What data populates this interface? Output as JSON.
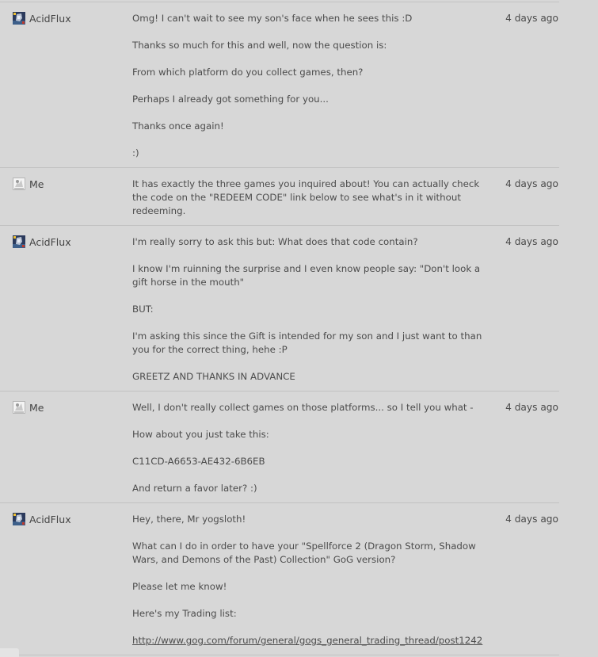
{
  "thread": {
    "messages": [
      {
        "sender": "AcidFlux",
        "avatar": "acidflux-avatar",
        "time": "4 days ago",
        "paragraphs": [
          "Omg! I can't wait to see my son's face when he sees this :D",
          "Thanks so much for this and well, now the question is:",
          "From which platform do you collect games, then?",
          "Perhaps I already got something for you...",
          "Thanks once again!",
          ":)"
        ]
      },
      {
        "sender": "Me",
        "avatar": "me-avatar",
        "time": "4 days ago",
        "paragraphs": [
          "It has exactly the three games you inquired about! You can actually check the code on the \"REDEEM CODE\" link below to see what's in it without redeeming."
        ]
      },
      {
        "sender": "AcidFlux",
        "avatar": "acidflux-avatar",
        "time": "4 days ago",
        "paragraphs": [
          "I'm really sorry to ask this but: What does that code contain?",
          "I know I'm ruinning the surprise and I even know people say: \"Don't look a gift horse in the mouth\"",
          "BUT:",
          "I'm asking this since the Gift is intended for my son and I just want to than you for the correct thing, hehe :P",
          "GREETZ AND THANKS IN ADVANCE"
        ]
      },
      {
        "sender": "Me",
        "avatar": "me-avatar",
        "time": "4 days ago",
        "paragraphs": [
          "Well, I don't really collect games on those platforms... so I tell you what -",
          "How about you just take this:",
          "C11CD-A6653-AE432-6B6EB",
          "And return a favor later? :)"
        ]
      },
      {
        "sender": "AcidFlux",
        "avatar": "acidflux-avatar",
        "time": "4 days ago",
        "paragraphs": [
          "Hey, there, Mr yogsloth!",
          "What can I do in order to have your \"Spellforce 2 (Dragon Storm, Shadow Wars, and Demons of the Past) Collection\" GoG version?",
          "Please let me know!",
          "Here's my Trading list:"
        ],
        "link": "http://www.gog.com/forum/general/gogs_general_trading_thread/post1242"
      }
    ]
  },
  "colors": {
    "background": "#d7d7d7",
    "divider": "#c2c2c2",
    "text": "#4c4c4c"
  }
}
